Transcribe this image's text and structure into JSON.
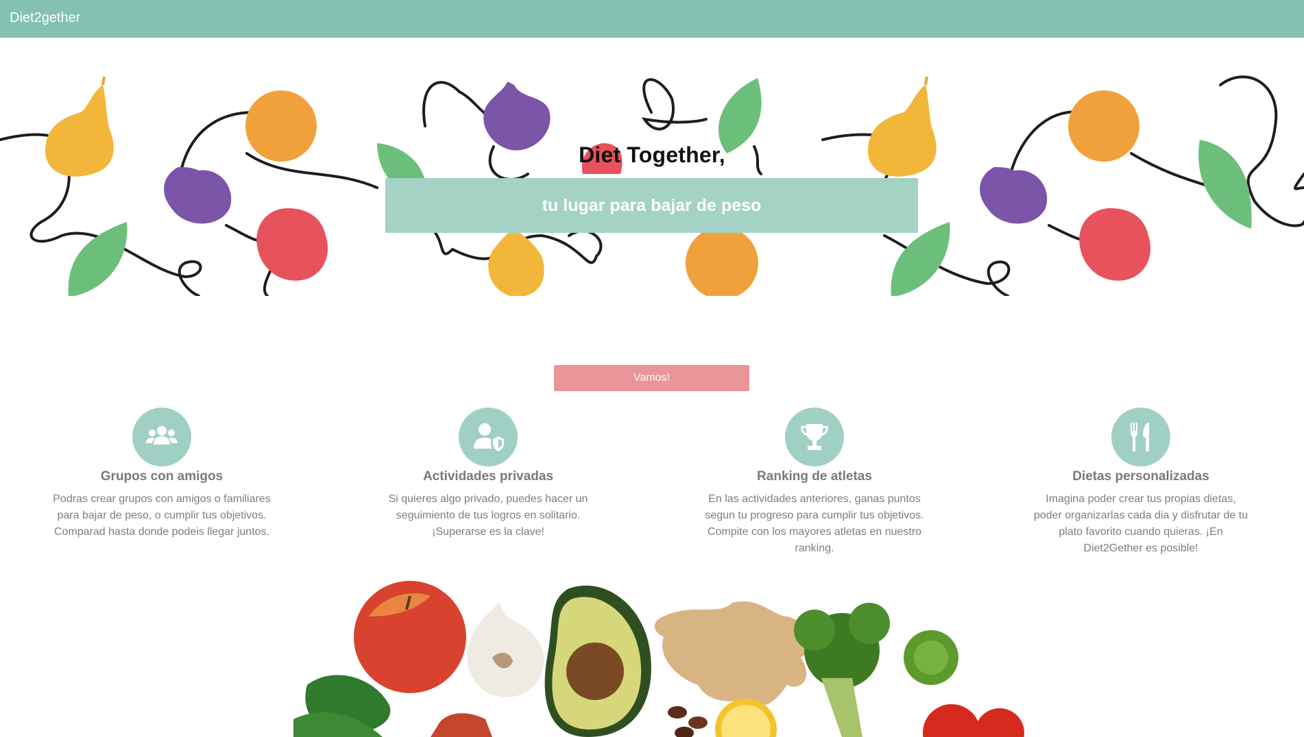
{
  "navbar": {
    "brand": "Diet2gether"
  },
  "hero": {
    "title": "Diet Together,",
    "subtitle": "tu lugar para bajar de peso"
  },
  "cta": {
    "label": "Vamos!"
  },
  "features": [
    {
      "icon": "users-icon",
      "title": "Grupos con amigos",
      "text": "Podras crear grupos con amigos o familiares para bajar de peso, o cumplir tus objetivos. Comparad hasta donde podeis llegar juntos."
    },
    {
      "icon": "user-shield-icon",
      "title": "Actividades privadas",
      "text": "Si quieres algo privado, puedes hacer un seguimiento de tus logros en solitario. ¡Superarse es la clave!"
    },
    {
      "icon": "trophy-icon",
      "title": "Ranking de atletas",
      "text": "En las actividades anteriores, ganas puntos segun tu progreso para cumplir tus objetivos. Compite con los mayores atletas en nuestro ranking."
    },
    {
      "icon": "utensils-icon",
      "title": "Dietas personalizadas",
      "text": "Imagina poder crear tus propias dietas, poder organizarlas cada dia y disfrutar de tu plato favorito cuando quieras. ¡En Diet2Gether es posible!"
    }
  ],
  "colors": {
    "navbar": "#84c1b0",
    "hero_band": "#a4d2c5",
    "cta": "#ea9599",
    "icon_circle": "#a0d0c4"
  }
}
